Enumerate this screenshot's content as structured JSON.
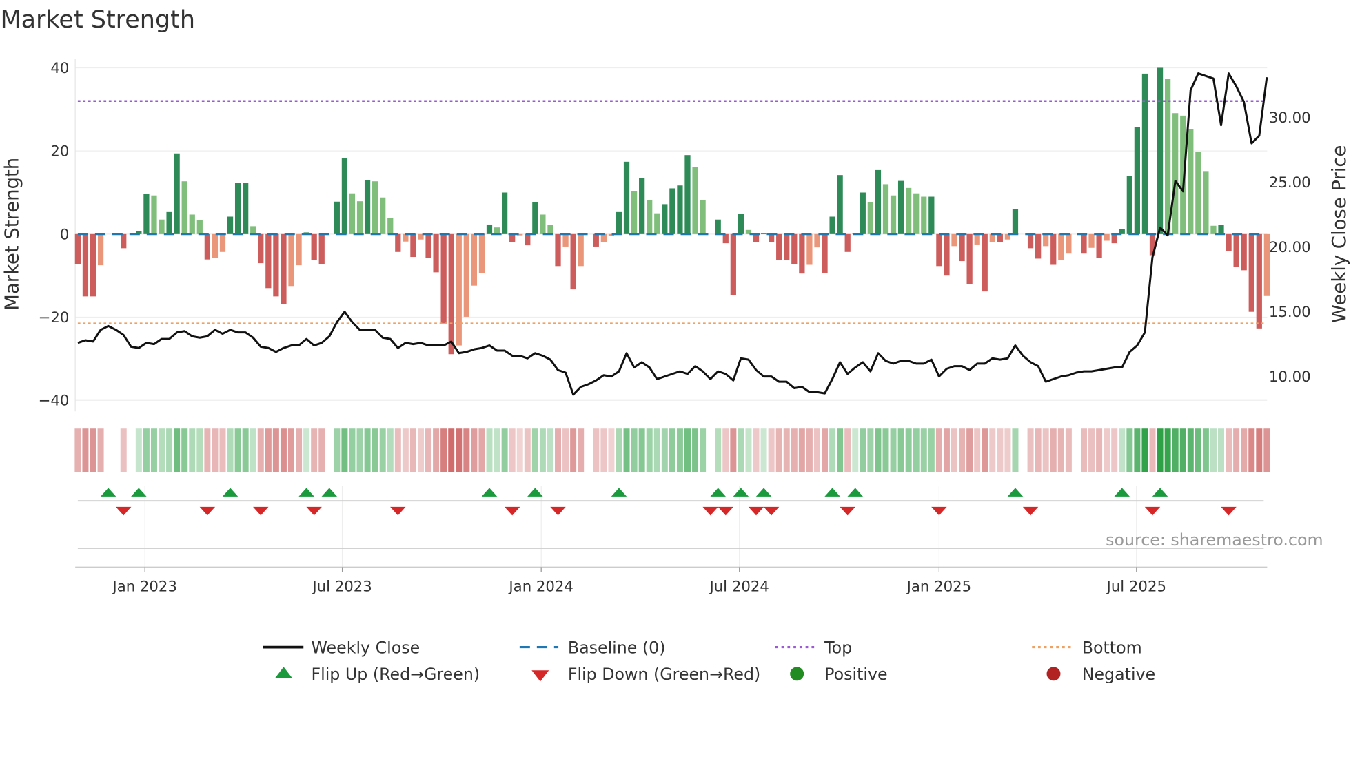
{
  "chart_data": {
    "type": "bar",
    "title": "Market Strength",
    "ylabel": "Market Strength",
    "y2label": "Weekly Close Price",
    "ylim": [
      -42,
      40
    ],
    "y2lim": [
      7.7,
      35.2
    ],
    "yticks": [
      40,
      20,
      0,
      -20,
      -40
    ],
    "yticklabels": [
      "40",
      "20",
      "0",
      "−20",
      "−40"
    ],
    "y2ticks": [
      30,
      25,
      20,
      15,
      10
    ],
    "y2ticklabels": [
      "30.00",
      "25.00",
      "20.00",
      "15.00",
      "10.00"
    ],
    "xtick_weeks": [
      8.8,
      34.7,
      60.8,
      86.8,
      113,
      138.9
    ],
    "xticklabels": [
      "Jan 2023",
      "Jul 2023",
      "Jan 2024",
      "Jul 2024",
      "Jan 2025",
      "Jul 2025"
    ],
    "top_line": 32,
    "bottom_line": -21.5,
    "baseline": 0,
    "strength": [
      -7.2,
      -15,
      -15,
      -7.5,
      0,
      0,
      -3.4,
      0,
      0.8,
      9.6,
      9.3,
      3.5,
      5.3,
      19.4,
      12.7,
      4.7,
      3.3,
      -6.1,
      -5.7,
      -4.3,
      4.2,
      12.3,
      12.3,
      1.9,
      -7,
      -13,
      -15,
      -16.8,
      -12.5,
      -7.5,
      0.4,
      -6.2,
      -7.2,
      0,
      7.8,
      18.2,
      9.8,
      7.9,
      13,
      12.7,
      8.8,
      3.8,
      -4.3,
      -1.8,
      -5.5,
      -1.3,
      -5.8,
      -9.2,
      -21.5,
      -28.9,
      -26.8,
      -19.9,
      -12.4,
      -9.4,
      2.3,
      1.6,
      10,
      -2,
      -0.3,
      -2.7,
      7.6,
      4.7,
      2.2,
      -7.7,
      -3,
      -13.3,
      -7.7,
      0,
      -3,
      -2,
      -0.5,
      5.3,
      17.4,
      10.3,
      13.4,
      8.1,
      5,
      7.2,
      11,
      11.7,
      19,
      16.2,
      8.2,
      0,
      3.5,
      -2.2,
      -14.7,
      4.8,
      1,
      -1.9,
      0.3,
      -2,
      -6.2,
      -6.3,
      -7.2,
      -9.5,
      -7.4,
      -3.2,
      -9.3,
      4.2,
      14.2,
      -4.3,
      0.3,
      10,
      7.7,
      15.4,
      12,
      9.3,
      12.8,
      11.1,
      9.8,
      9,
      9,
      -7.7,
      -10,
      -2.9,
      -6.5,
      -12,
      -2.5,
      -13.8,
      -1.9,
      -1.9,
      -1.3,
      6.1,
      0,
      -3.4,
      -5.9,
      -2.9,
      -7.4,
      -6.2,
      -4.7,
      0,
      -4.7,
      -3.3,
      -5.7,
      -1.6,
      -2.2,
      1.2,
      14,
      25.8,
      38.6,
      -5.1,
      40,
      37.3,
      29.1,
      28.5,
      25.2,
      19.7,
      15,
      2,
      2.2,
      -4,
      -7.9,
      -8.7,
      -18.7,
      -22.7,
      -14.9
    ],
    "weekly_close": [
      12.6,
      12.8,
      12.7,
      13.6,
      13.9,
      13.6,
      13.2,
      12.3,
      12.2,
      12.6,
      12.5,
      12.9,
      12.9,
      13.4,
      13.5,
      13.1,
      13.0,
      13.1,
      13.6,
      13.3,
      13.6,
      13.4,
      13.4,
      13.0,
      12.3,
      12.2,
      11.9,
      12.2,
      12.4,
      12.4,
      12.9,
      12.4,
      12.6,
      13.1,
      14.2,
      15.0,
      14.2,
      13.6,
      13.6,
      13.6,
      13.0,
      12.9,
      12.2,
      12.6,
      12.5,
      12.6,
      12.4,
      12.4,
      12.4,
      12.7,
      11.8,
      11.9,
      12.1,
      12.2,
      12.4,
      12.0,
      12.0,
      11.6,
      11.6,
      11.4,
      11.8,
      11.6,
      11.3,
      10.5,
      10.3,
      8.6,
      9.2,
      9.4,
      9.7,
      10.1,
      10.0,
      10.4,
      11.8,
      10.7,
      11.1,
      10.7,
      9.8,
      10.0,
      10.2,
      10.4,
      10.2,
      10.8,
      10.4,
      9.8,
      10.4,
      10.2,
      9.7,
      11.4,
      11.3,
      10.5,
      10.0,
      10.0,
      9.6,
      9.6,
      9.1,
      9.2,
      8.8,
      8.8,
      8.7,
      9.8,
      11.1,
      10.2,
      10.7,
      11.1,
      10.4,
      11.8,
      11.2,
      11.0,
      11.2,
      11.2,
      11.0,
      11.0,
      11.3,
      10.0,
      10.6,
      10.8,
      10.8,
      10.5,
      11.0,
      11.0,
      11.4,
      11.3,
      11.4,
      12.4,
      11.6,
      11.1,
      10.8,
      9.6,
      9.8,
      10.0,
      10.1,
      10.3,
      10.4,
      10.4,
      10.5,
      10.6,
      10.7,
      10.7,
      11.9,
      12.4,
      13.4,
      19.2,
      21.5,
      20.9,
      25.1,
      24.3,
      32.1,
      33.4,
      33.2,
      33.0,
      29.4,
      33.4,
      32.4,
      31.2,
      28.0,
      28.6,
      33.1
    ],
    "flip_up_weeks": [
      4,
      8,
      20,
      30,
      33,
      54,
      60,
      71,
      84,
      87,
      90,
      99,
      102,
      123,
      137,
      142
    ],
    "flip_down_weeks": [
      6,
      17,
      24,
      31,
      42,
      57,
      63,
      83,
      85,
      89,
      91,
      101,
      113,
      125,
      141,
      151
    ],
    "colors": {
      "rising_positive": "#2e8b57",
      "falling_positive": "#7fbf7b",
      "falling_negative": "#cd5c5c",
      "rising_negative": "#e9967a",
      "baseline": "#1f77b4",
      "top": "#9b59d6",
      "bottom": "#f0a060",
      "close": "#111111",
      "flip_up": "#1a9a3c",
      "flip_down": "#d62728",
      "positive": "#228b22",
      "negative": "#b22222"
    },
    "legend": {
      "weekly_close": "Weekly Close",
      "baseline": "Baseline (0)",
      "top": "Top",
      "bottom": "Bottom",
      "flip_up": "Flip Up (Red→Green)",
      "flip_down": "Flip Down (Green→Red)",
      "positive": "Positive",
      "negative": "Negative"
    },
    "legend_placement": "bottom",
    "source": "source: sharemaestro.com"
  }
}
